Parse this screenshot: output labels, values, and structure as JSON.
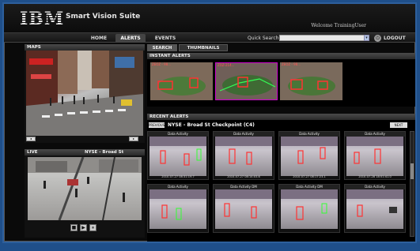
{
  "header": {
    "logo": "IBM",
    "suite": "Smart Vision Suite",
    "welcome": "Welcome TrainingUser"
  },
  "nav": {
    "tabs": [
      {
        "label": "HOME",
        "active": false
      },
      {
        "label": "ALERTS",
        "active": true
      },
      {
        "label": "EVENTS",
        "active": false
      }
    ],
    "quick_search_label": "Quick Search",
    "quick_search_value": "",
    "logout": "LOGOUT"
  },
  "maps": {
    "title": "MAPS"
  },
  "live": {
    "title": "LIVE",
    "camera": "NYSE - Broad St"
  },
  "subtabs": [
    {
      "label": "SEARCH",
      "active": true
    },
    {
      "label": "THUMBNAILS",
      "active": false
    }
  ],
  "instant_alerts": {
    "title": "INSTANT ALERTS",
    "items": [
      {
        "label": "ZEOZ - 98..."
      },
      {
        "label": "ZOZ-214..."
      },
      {
        "label": "ZEOZ - 98..."
      }
    ]
  },
  "recent_alerts": {
    "title": "RECENT ALERTS",
    "prev": "PREVIOUS",
    "camera_title": "NYSE - Broad St Checkpoint (C4)",
    "next": "NEXT",
    "cells": [
      {
        "title": "Data Activity",
        "ts": "2010-07-27 08:31:19.7"
      },
      {
        "title": "Data Activity",
        "ts": "2010-07-27 08:14:03.6"
      },
      {
        "title": "Data Activity",
        "ts": "2010-07-27 08:17:23.1"
      },
      {
        "title": "Data Activity",
        "ts": "2010-07-28 18:51:41.0"
      },
      {
        "title": "Data Activity",
        "ts": ""
      },
      {
        "title": "Data Activity DM",
        "ts": ""
      },
      {
        "title": "Data Activity DM",
        "ts": ""
      },
      {
        "title": "Data Activity",
        "ts": ""
      }
    ]
  }
}
